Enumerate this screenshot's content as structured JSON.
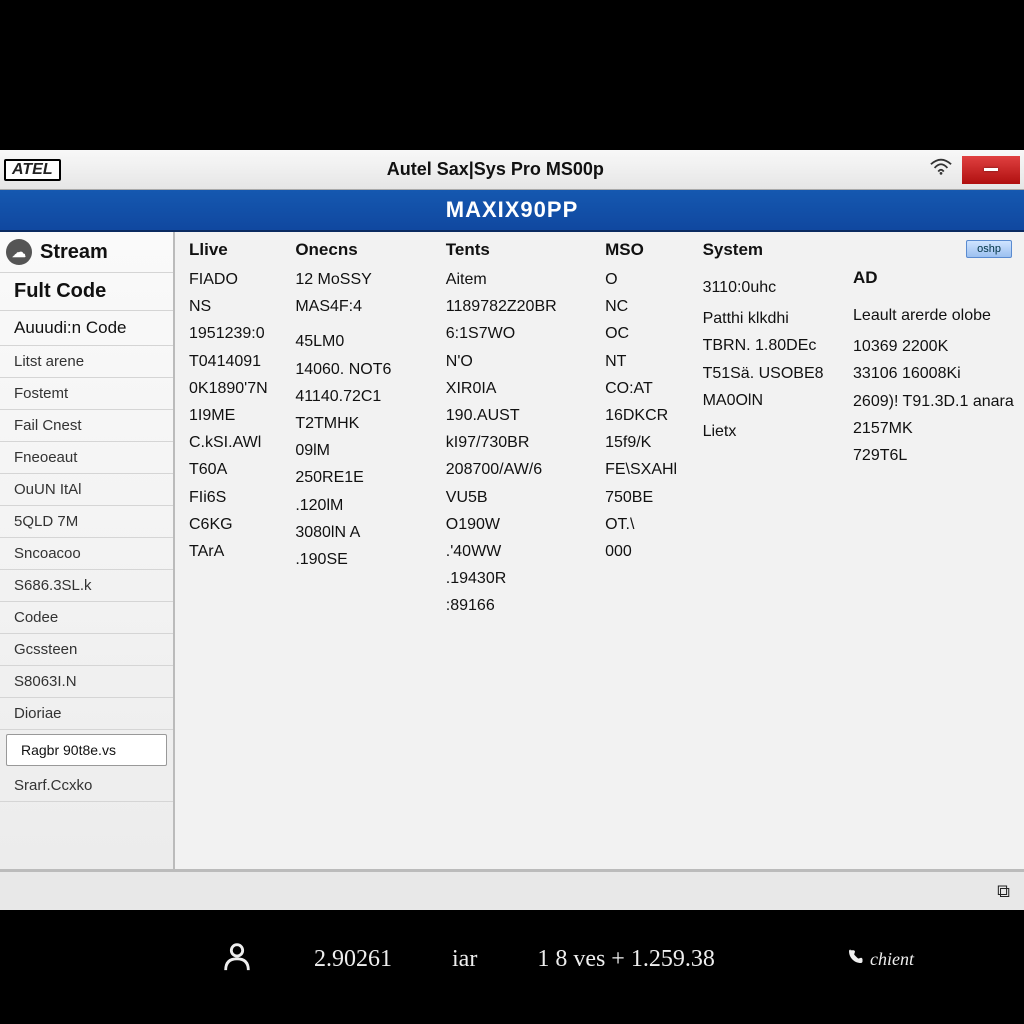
{
  "titlebar": {
    "brand": "ATEL",
    "title": "Autel Sax|Sys Pro MS00p"
  },
  "banner": {
    "text": "MAXIX90PP"
  },
  "sidebar": {
    "items": [
      {
        "label": "Stream",
        "primary": true,
        "icon": "cloud"
      },
      {
        "label": "Fult Code",
        "primary": true
      },
      {
        "label": "Auuudi:n Code"
      },
      {
        "label": "Litst arene",
        "sub": true
      },
      {
        "label": "Fostemt",
        "sub": true
      },
      {
        "label": "Fail Cnest",
        "sub": true
      },
      {
        "label": "Fneoeaut",
        "sub": true
      },
      {
        "label": "OuUN ItAl",
        "sub": true
      },
      {
        "label": "5QLD 7M",
        "sub": true
      },
      {
        "label": "Sncoacoo",
        "sub": true
      },
      {
        "label": "S686.3SL.k",
        "sub": true
      },
      {
        "label": "Codee",
        "sub": true
      },
      {
        "label": "Gcssteen",
        "sub": true
      },
      {
        "label": "S8063I.N",
        "sub": true
      },
      {
        "label": "Dioriae",
        "sub": true
      },
      {
        "label": "Ragbr 90t8e.vs",
        "box": true
      },
      {
        "label": "Srarf.Ccxko",
        "sub": true
      }
    ]
  },
  "columns": [
    {
      "header": "Llive",
      "cells": [
        "FIADO",
        "NS",
        "1951239:0",
        "T0414091",
        "0K1890'7N",
        "1I9ME",
        "C.kSI.AWl",
        "T60A",
        "FIi6S",
        "C6KG",
        "TArA"
      ]
    },
    {
      "header": "Onecns",
      "cells": [
        "12 MoSSY",
        "MAS4F:4",
        "",
        "",
        "45LM0",
        "14060. NOT6",
        "41140.72C1",
        "T2TMHK",
        "09lM",
        "250RE1E",
        ".120lM",
        "3080lN A",
        ".190SE"
      ]
    },
    {
      "header": "Tents",
      "cells": [
        "Aitem",
        "1189782Z20BR",
        "6:1S7WO",
        "N'O",
        "XIR0IA",
        "190.AUST",
        "kI97/730BR",
        "208700/AW/6",
        "VU5B",
        "O190W",
        ".'40WW",
        ".19430R",
        ":89166"
      ]
    },
    {
      "header": "MSO",
      "cells": [
        "O",
        "NC",
        "OC",
        "NT",
        "CO:AT",
        "16DKCR",
        "15f9/K",
        "FE\\SXAHl",
        "750BE",
        "OT.\\",
        "000"
      ]
    },
    {
      "header": "System",
      "cells": [
        "",
        "",
        "3110:0uhc",
        "",
        "Patthi  klkdhi",
        "TBRN. 1.80DEc",
        "T51Sä.  USOBE8",
        "MA0OlN",
        "",
        "Lietx"
      ]
    },
    {
      "header": "AD",
      "cells": [
        "",
        "",
        "Leault arerde olobe",
        "",
        "10369 2200K",
        "33106  16008Ki",
        "2609)!  T91.3D.1 anara",
        "2157MK",
        "729T6L"
      ]
    }
  ],
  "side_chip": "oshp",
  "footer_icon": "⧉",
  "status": {
    "value": "2.90261",
    "unit": "iar",
    "mid": "1 8 ves  +  1.259.38",
    "right": "chient"
  }
}
